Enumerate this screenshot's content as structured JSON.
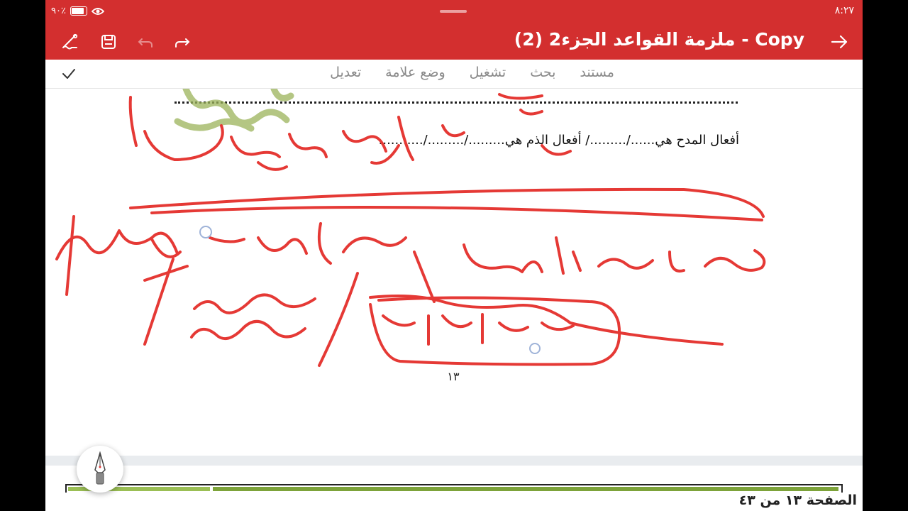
{
  "status_bar": {
    "battery": "٩٠٪",
    "time": "٨:٢٧"
  },
  "toolbar": {
    "title": "ملزمة القواعد الجزء2 (2) - Copy",
    "icons": [
      "back-arrow-icon",
      "redo-icon",
      "undo-icon",
      "save-icon",
      "pen-draw-icon"
    ]
  },
  "menu": {
    "items": [
      "مستند",
      "بحث",
      "تشغيل",
      "وضع علامة",
      "تعديل"
    ]
  },
  "document": {
    "line_text": "أفعال المدح هي....../........./ أفعال الذم هي........./........./...........",
    "page_number": "١٣"
  },
  "footer": {
    "page_indicator": "الصفحة ١٣ من ٤٣"
  },
  "colors": {
    "accent": "#d32f2f",
    "ink": "#e53935",
    "highlighter": "#9bb35a"
  }
}
